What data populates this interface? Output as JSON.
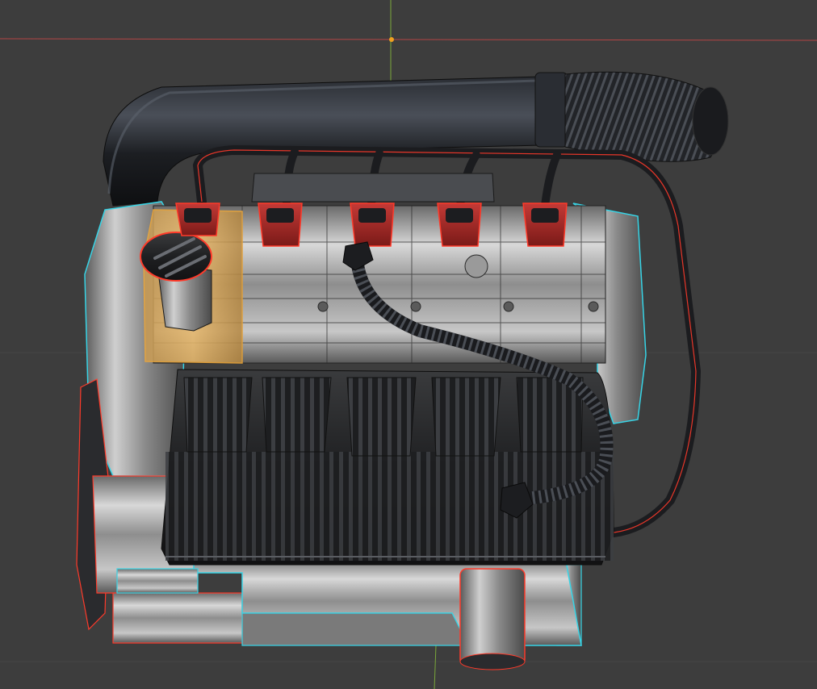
{
  "viewport": {
    "background": "#3d3d3d",
    "grid_color": "#454545",
    "x_axis_color": "#b34545",
    "y_axis_color": "#7aa83a",
    "origin_color": "#f0a020"
  },
  "selection": {
    "outline_color": "#ff3a2a",
    "active_outline_color": "#37d4e6",
    "active_face_color": "#f0a838"
  },
  "model": {
    "plug_count": 5,
    "manifold_runners": 5
  }
}
